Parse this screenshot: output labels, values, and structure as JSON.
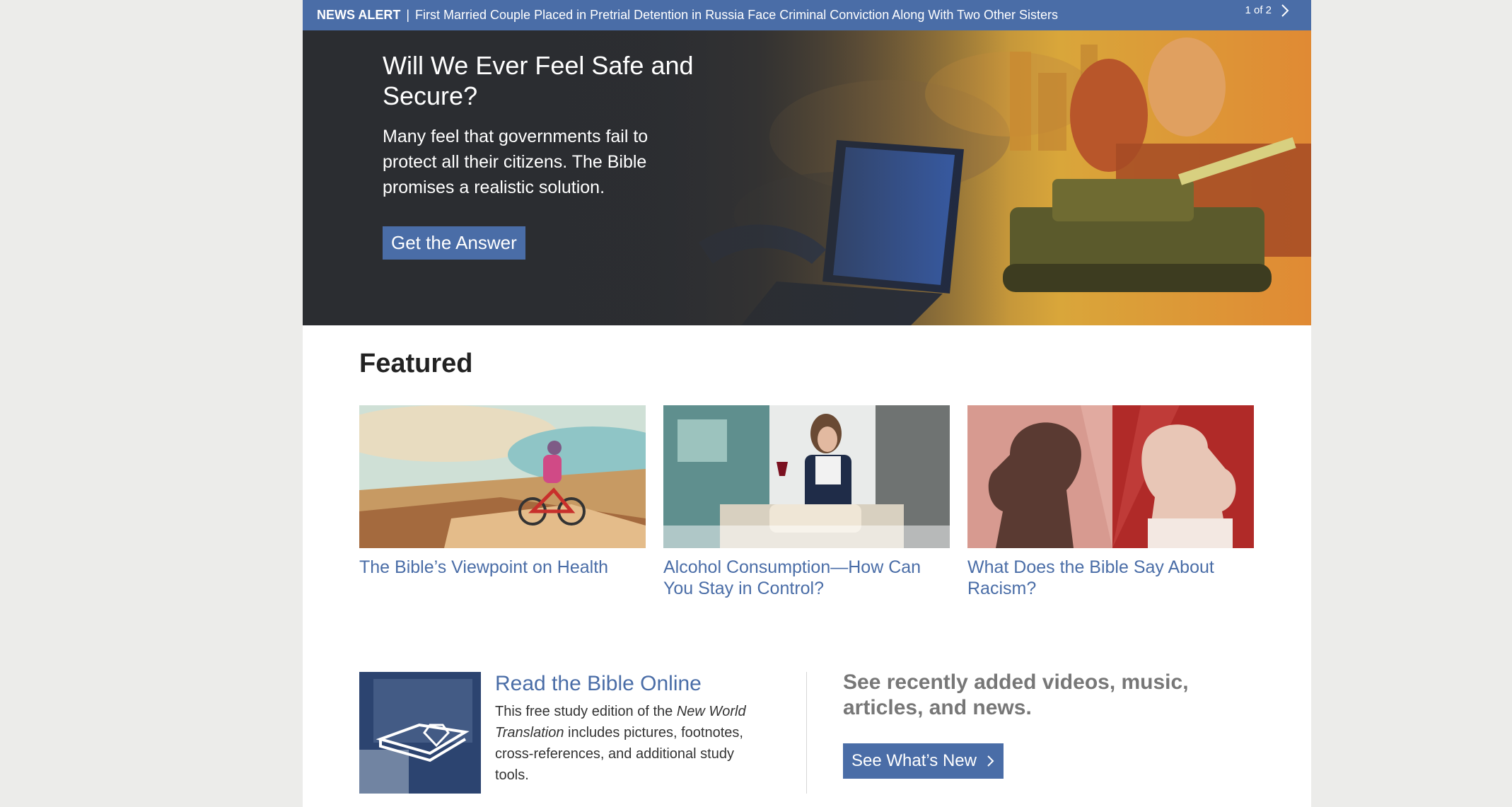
{
  "alert": {
    "label": "NEWS ALERT",
    "separator": "|",
    "headline": "First Married Couple Placed in Pretrial Detention in Russia Face Criminal Conviction Along With Two Other Sisters",
    "pager": "1 of 2",
    "next_icon": "chevron-right-icon"
  },
  "hero": {
    "title": "Will We Ever Feel Safe and Secure?",
    "text": "Many feel that governments fail to protect all their citizens. The Bible promises a realistic solution.",
    "button": "Get the Answer"
  },
  "featured": {
    "heading": "Featured",
    "items": [
      {
        "title": "The Bible’s Viewpoint on Health"
      },
      {
        "title": "Alcohol Consumption—How Can You Stay in Control?"
      },
      {
        "title": "What Does the Bible Say About Racism?"
      }
    ]
  },
  "bible": {
    "link": "Read the Bible Online",
    "text_before": "This free study edition of the ",
    "text_italic": "New World Translation",
    "text_after": " includes pictures, footnotes, cross-references, and additional study tools."
  },
  "whats_new": {
    "text": "See recently added videos, music, articles, and news.",
    "button": "See What’s New",
    "button_icon": "chevron-right-icon"
  },
  "colors": {
    "accent": "#4a6da7",
    "hero_bg": "#2b2d31",
    "page_bg": "#ececea",
    "muted_text": "#777777"
  }
}
